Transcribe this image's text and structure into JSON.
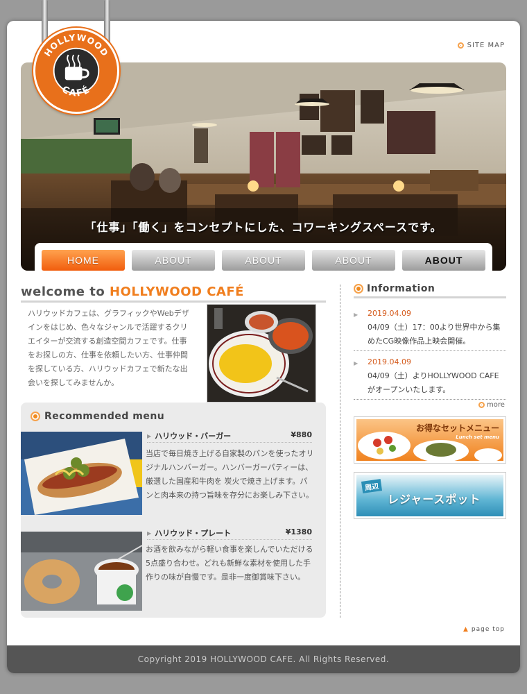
{
  "header": {
    "logo_text_top": "HOLLYWOOD",
    "logo_text_bottom": "CAFÉ",
    "sitemap_label": "SITE MAP"
  },
  "hero": {
    "tagline": "「仕事」「働く」をコンセプトにした、コワーキングスペースです。"
  },
  "nav": {
    "items": [
      {
        "label": "HOME",
        "active": true
      },
      {
        "label": "ABOUT",
        "active": false
      },
      {
        "label": "ABOUT",
        "active": false
      },
      {
        "label": "ABOUT",
        "active": false
      },
      {
        "label": "ABOUT",
        "active": false
      }
    ]
  },
  "welcome": {
    "prefix": "welcome to ",
    "name": "HOLLYWOOD CAFÉ",
    "text": "ハリウッドカフェは、グラフィックやWebデザインをはじめ、色々なジャンルで活躍するクリエイターが交流する創造空間カフェです。仕事をお探しの方、仕事を依頼したい方、仕事仲間を探している方、ハリウッドカフェで新たな出会いを探してみませんか。"
  },
  "recommended": {
    "title": "Recommended menu",
    "items": [
      {
        "name": "ハリウッド・バーガー",
        "price": "¥880",
        "description": "当店で毎日焼き上げる自家製のパンを使ったオリジナルハンバーガー。ハンバーガーパティーは、厳選した国産和牛肉を 炭火で焼き上げます。パンと肉本来の持つ旨味を存分にお楽しみ下さい。"
      },
      {
        "name": "ハリウッド・プレート",
        "price": "¥1380",
        "description": "お酒を飲みながら軽い食事を楽しんでいただける5点盛り合わせ。どれも新鮮な素材を使用した手作りの味が自慢です。是非一度御賞味下さい。"
      }
    ]
  },
  "information": {
    "title": "Information",
    "news": [
      {
        "date": "2019.04.09",
        "text": "04/09（土）17：00より世界中から集めたCG映像作品上映会開催。"
      },
      {
        "date": "2019.04.09",
        "text": "04/09（土）よりHOLLYWOOD CAFEがオープンいたします。"
      }
    ],
    "more_label": "more"
  },
  "banners": {
    "set_menu": {
      "title": "お得なセットメニュー",
      "subtitle": "Lunch set menu"
    },
    "leisure": {
      "tag": "周辺",
      "title": "レジャースポット"
    }
  },
  "page_top_label": "page top",
  "footer": {
    "copyright": "Copyright 2019 HOLLYWOOD CAFE. All Rights Reserved."
  },
  "colors": {
    "accent": "#f07e1e",
    "nav_active": "#f15d0d",
    "footer_bg": "#555555"
  }
}
